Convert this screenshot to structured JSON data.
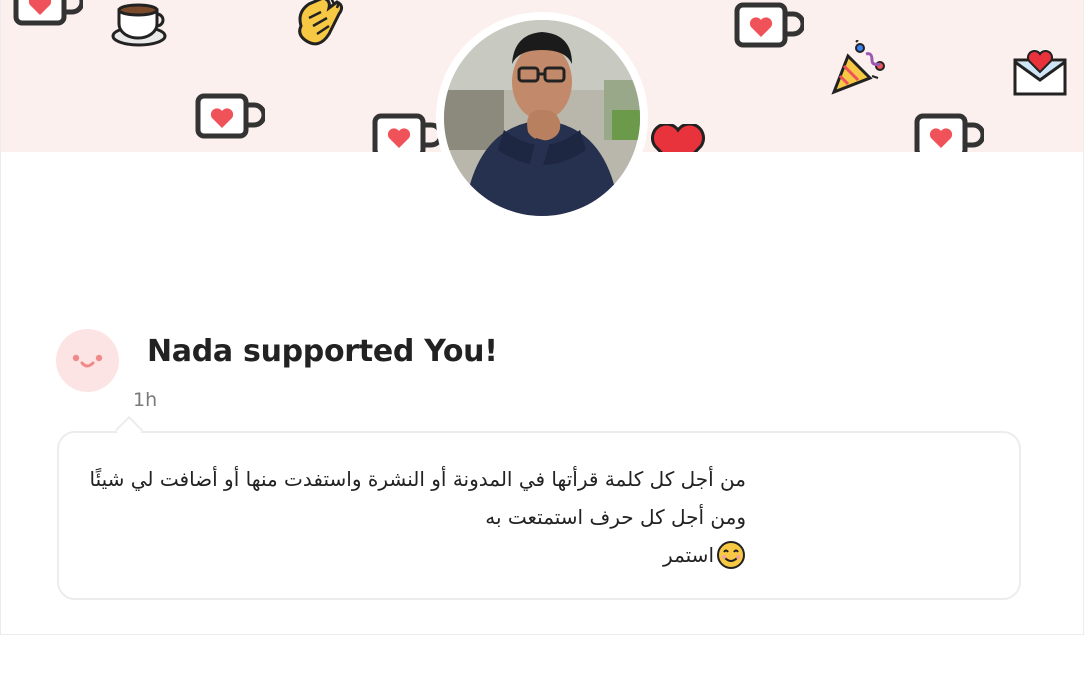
{
  "supporter": {
    "headline": "Nada supported You!",
    "time": "1h"
  },
  "message": {
    "line1": "من أجل كل كلمة قرأتها في المدونة أو النشرة واستفدت منها أو أضافت لي شيئًا",
    "line2": "ومن أجل كل حرف استمتعت به",
    "line3": "استمر"
  },
  "colors": {
    "banner": "#fcf0ee",
    "heart": "#f0525a",
    "supporter_avatar_bg": "#fde4e4",
    "text": "#222222",
    "muted": "#7a7a7a"
  },
  "icons": [
    "coffee-mug-icon",
    "hot-coffee-icon",
    "clapping-hands-icon",
    "party-popper-icon",
    "love-letter-icon",
    "red-heart-icon",
    "smiling-face-icon"
  ]
}
